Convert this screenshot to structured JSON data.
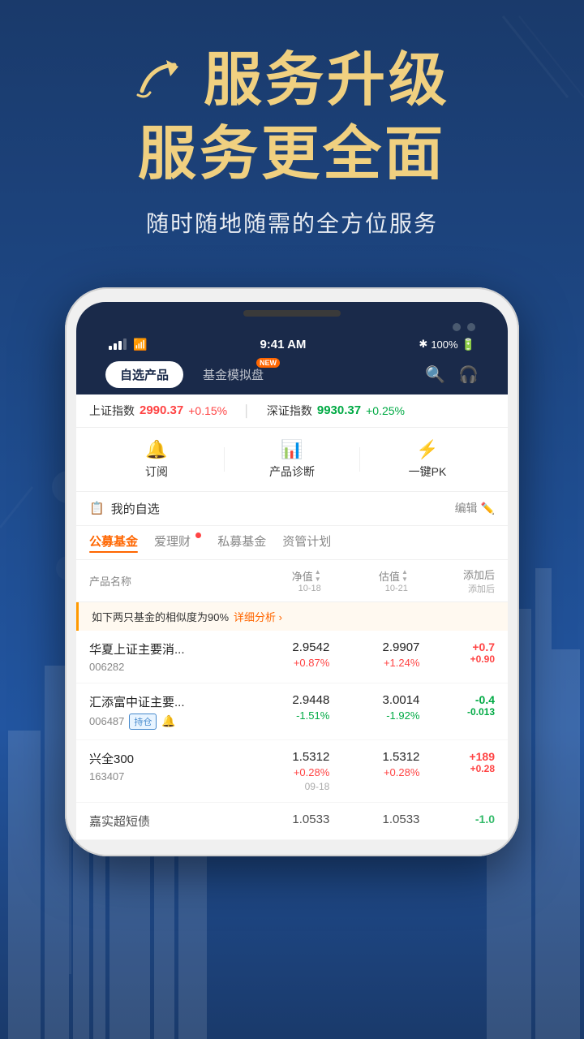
{
  "promo": {
    "title_line1_prefix": "↗",
    "title_line1": "服务升级",
    "title_line2": "服务更全面",
    "subtitle": "随时随地随需的全方位服务"
  },
  "status_bar": {
    "time": "9:41 AM",
    "battery": "100%",
    "bluetooth": "✱"
  },
  "tabs": [
    {
      "label": "自选产品",
      "active": true,
      "new_badge": false
    },
    {
      "label": "基金模拟盘",
      "active": false,
      "new_badge": true
    }
  ],
  "market": {
    "items": [
      {
        "label": "上证指数",
        "value": "2990.37",
        "change": "+0.15%",
        "positive": true
      },
      {
        "label": "深证指数",
        "value": "9930.37",
        "change": "+0.25%",
        "positive": false
      }
    ]
  },
  "actions": [
    {
      "icon": "🔔",
      "label": "订阅"
    },
    {
      "icon": "📊",
      "label": "产品诊断"
    },
    {
      "icon": "⚡",
      "label": "一键PK"
    }
  ],
  "watchlist": {
    "title": "我的自选",
    "edit_label": "编辑"
  },
  "categories": [
    {
      "label": "公募基金",
      "active": true,
      "dot": false
    },
    {
      "label": "爱理财",
      "active": false,
      "dot": true
    },
    {
      "label": "私募基金",
      "active": false,
      "dot": false
    },
    {
      "label": "资管计划",
      "active": false,
      "dot": false
    }
  ],
  "table_header": {
    "col1": "产品名称",
    "col2_label": "净值",
    "col2_date": "10-18",
    "col3_label": "估值",
    "col3_date": "10-21",
    "col4_label": "添加后",
    "col4_sub": "添加后"
  },
  "similarity_notice": {
    "text": "如下两只基金的相似度为90%",
    "highlight": "90%",
    "link": "详细分析 ›"
  },
  "funds": [
    {
      "name": "华夏上证主要消...",
      "code": "006282",
      "tag": null,
      "bell": false,
      "nav": "2.9542",
      "nav_change": "+0.87%",
      "nav_positive": true,
      "est": "2.9907",
      "est_change": "+1.24%",
      "est_positive": true,
      "return": "+0.7",
      "return_sub": "+0.90",
      "return_positive": true,
      "date": null
    },
    {
      "name": "汇添富中证主要...",
      "code": "006487",
      "tag": "持仓",
      "bell": true,
      "nav": "2.9448",
      "nav_change": "-1.51%",
      "nav_positive": false,
      "est": "3.0014",
      "est_change": "-1.92%",
      "est_positive": false,
      "return": "-0.4",
      "return_sub": "-0.013",
      "return_positive": false,
      "date": null
    },
    {
      "name": "兴全300",
      "code": "163407",
      "tag": null,
      "bell": false,
      "nav": "1.5312",
      "nav_change": "+0.28%",
      "nav_positive": true,
      "est": "1.5312",
      "est_change": "+0.28%",
      "est_positive": true,
      "return": "+189",
      "return_sub": "+0.28",
      "return_positive": true,
      "date": "09-18"
    },
    {
      "name": "嘉实超短债",
      "code": "",
      "tag": null,
      "bell": false,
      "nav": "1.0533",
      "nav_change": "",
      "nav_positive": true,
      "est": "1.0533",
      "est_change": "",
      "est_positive": true,
      "return": "-1.0",
      "return_sub": "",
      "return_positive": false,
      "date": null
    }
  ]
}
